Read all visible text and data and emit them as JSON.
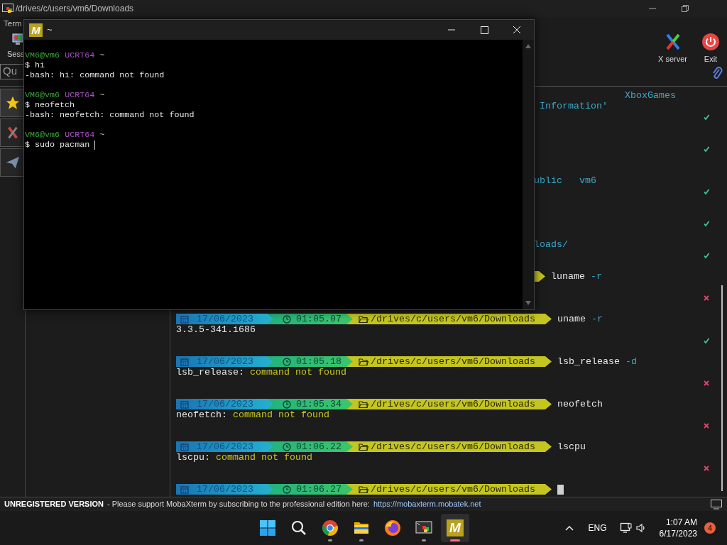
{
  "background_window": {
    "title": "/drives/c/users/vm6/Downloads",
    "menu_fragment": "Term",
    "sessions_label": "Sess",
    "quick_connect_placeholder": "Qu",
    "toolbar_right": [
      {
        "kind": "xserver",
        "label": "X server"
      },
      {
        "kind": "exit",
        "label": "Exit"
      }
    ],
    "side_tabs": [
      {
        "kind": "star",
        "selected": true
      },
      {
        "kind": "tools",
        "selected": false
      },
      {
        "kind": "send",
        "selected": false
      }
    ],
    "terminal": {
      "lines": [
        {
          "kind": "fragment",
          "text": "XboxGames"
        },
        {
          "kind": "fragment",
          "text": "Information'"
        },
        {
          "kind": "status",
          "success": true
        },
        {
          "kind": "status",
          "success": true
        },
        {
          "kind": "fragment",
          "text": "ublic"
        },
        {
          "kind": "fragment",
          "text": "vm6"
        },
        {
          "kind": "status",
          "success": true
        },
        {
          "kind": "status",
          "success": true
        },
        {
          "kind": "fragment",
          "text": "loads/"
        },
        {
          "kind": "status",
          "success": true
        },
        {
          "kind": "prompt_tail",
          "command": "luname",
          "args": "-r"
        },
        {
          "kind": "status",
          "success": false
        },
        {
          "kind": "prompt",
          "date": "17/06/2023",
          "time": "01:05.07",
          "path": "/drives/c/users/vm6/Downloads",
          "command": "uname",
          "args": "-r",
          "cursor": false
        },
        {
          "kind": "output",
          "text": "3.3.5-341.i686"
        },
        {
          "kind": "status",
          "success": true
        },
        {
          "kind": "prompt",
          "date": "17/06/2023",
          "time": "01:05.18",
          "path": "/drives/c/users/vm6/Downloads",
          "command": "lsb_release",
          "args": "-d",
          "cursor": false
        },
        {
          "kind": "output",
          "text": "lsb_release:",
          "message": "command not found"
        },
        {
          "kind": "status",
          "success": false
        },
        {
          "kind": "prompt",
          "date": "17/06/2023",
          "time": "01:05.34",
          "path": "/drives/c/users/vm6/Downloads",
          "command": "neofetch",
          "cursor": false
        },
        {
          "kind": "output",
          "text": "neofetch:",
          "message": "command not found"
        },
        {
          "kind": "status",
          "success": false
        },
        {
          "kind": "prompt",
          "date": "17/06/2023",
          "time": "01:06.22",
          "path": "/drives/c/users/vm6/Downloads",
          "command": "lscpu",
          "cursor": false
        },
        {
          "kind": "output",
          "text": "lscpu:",
          "message": "command not found"
        },
        {
          "kind": "status",
          "success": false
        },
        {
          "kind": "prompt",
          "date": "17/06/2023",
          "time": "01:06.27",
          "path": "/drives/c/users/vm6/Downloads",
          "cursor": true
        }
      ]
    },
    "status_bar": {
      "notice": "UNREGISTERED VERSION",
      "message": "- Please support MobaXterm by subscribing to the professional edition here:",
      "link": "https://mobaxterm.mobatek.net"
    }
  },
  "front_window": {
    "logo": "M",
    "title": "~",
    "lines": [
      {
        "kind": "prompt",
        "user": "VM6@vm6",
        "env": "UCRT64",
        "dir": "~"
      },
      {
        "kind": "command",
        "text": "$ hi",
        "cursor": false
      },
      {
        "kind": "output",
        "text": "-bash: hi: command not found"
      },
      {
        "kind": "prompt",
        "user": "VM6@vm6",
        "env": "UCRT64",
        "dir": "~"
      },
      {
        "kind": "command",
        "text": "$ neofetch",
        "cursor": false
      },
      {
        "kind": "output",
        "text": "-bash: neofetch: command not found"
      },
      {
        "kind": "prompt",
        "user": "VM6@vm6",
        "env": "UCRT64",
        "dir": "~"
      },
      {
        "kind": "command",
        "text": "$ sudo pacman",
        "cursor": true
      }
    ]
  },
  "taskbar": {
    "apps": [
      {
        "kind": "start",
        "running": false,
        "active": false
      },
      {
        "kind": "search",
        "running": false,
        "active": false
      },
      {
        "kind": "chrome",
        "running": true,
        "active": false
      },
      {
        "kind": "explorer",
        "running": true,
        "active": false
      },
      {
        "kind": "firefox",
        "running": false,
        "active": false
      },
      {
        "kind": "terminal",
        "running": true,
        "active": false
      },
      {
        "kind": "mobaxterm",
        "logo": "M",
        "running": true,
        "active": true
      }
    ],
    "tray": {
      "language": "ENG",
      "time": "1:07 AM",
      "date": "6/17/2023",
      "notifications": "4"
    }
  }
}
